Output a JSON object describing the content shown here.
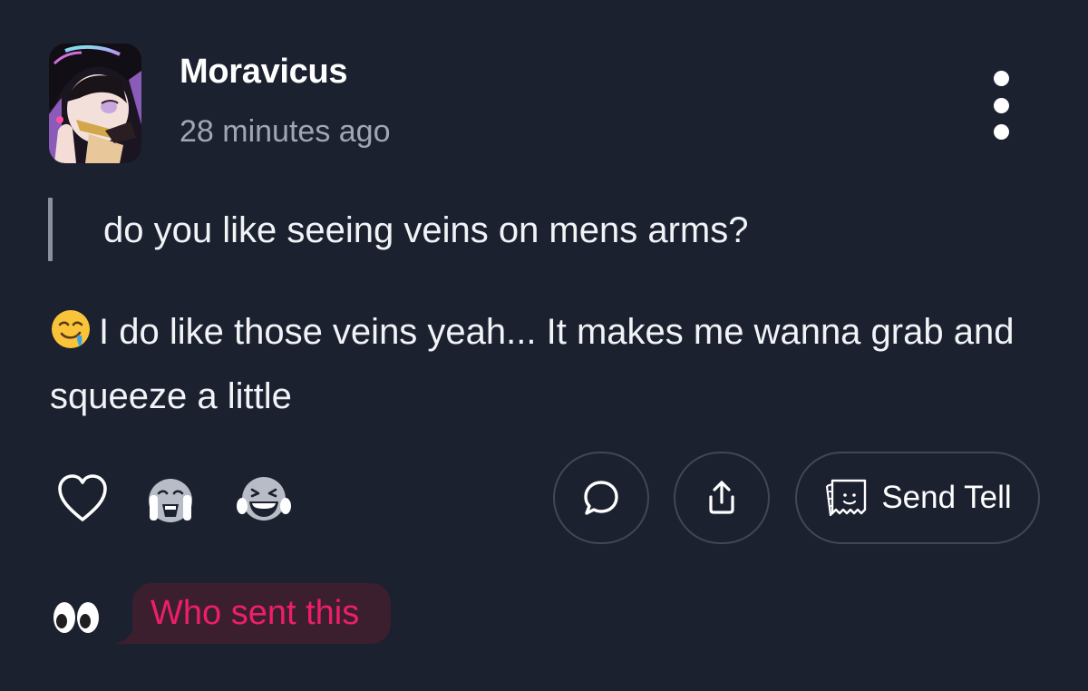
{
  "post": {
    "username": "Moravicus",
    "time": "28 minutes ago",
    "question": "do you like seeing veins on mens arms?",
    "answer": "I do like those veins yeah... It makes me wanna grab and squeeze a little",
    "answer_emoji": "drooling-face-icon"
  },
  "actions": {
    "reactions": [
      "heart-icon",
      "crying-face-icon",
      "laughing-face-icon"
    ],
    "comment_icon": "comment-icon",
    "share_icon": "share-icon",
    "send_tell_label": "Send Tell"
  },
  "footer": {
    "eyes_icon": "eyes-icon",
    "who_sent_label": "Who sent this"
  },
  "colors": {
    "background": "#1c2130",
    "accent_pink": "#ee1e68",
    "bubble_bg": "#3b1f2f",
    "muted_text": "#a2a6b2",
    "pill_border": "#404758"
  }
}
